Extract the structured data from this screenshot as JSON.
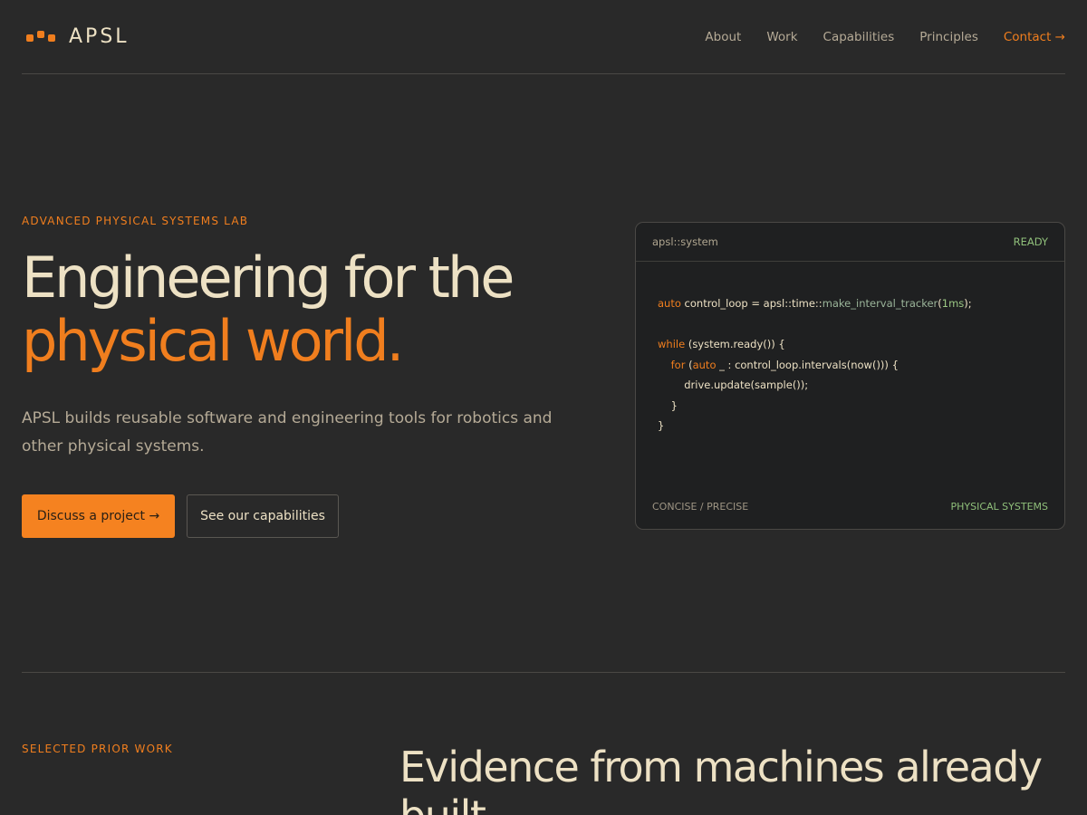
{
  "brand": {
    "name": "APSL"
  },
  "nav": {
    "items": [
      "About",
      "Work",
      "Capabilities",
      "Principles"
    ],
    "contact": "Contact →"
  },
  "hero": {
    "eyebrow": "ADVANCED PHYSICAL SYSTEMS LAB",
    "headline_line1": "Engineering for the",
    "headline_line2": "physical world.",
    "lede": "APSL builds reusable software and engineering tools for robotics and other physical systems.",
    "primary_cta": "Discuss a project →",
    "secondary_cta": "See our capabilities"
  },
  "code_card": {
    "title": "apsl::system",
    "status": "READY",
    "footer_left": "CONCISE / PRECISE",
    "footer_right": "PHYSICAL SYSTEMS",
    "lines": [
      [
        {
          "t": "kw",
          "s": "auto"
        },
        {
          "t": "txt",
          "s": " control_loop = apsl::time::"
        },
        {
          "t": "fn",
          "s": "make_interval_tracker"
        },
        {
          "t": "txt",
          "s": "("
        },
        {
          "t": "num",
          "s": "1ms"
        },
        {
          "t": "txt",
          "s": ");"
        }
      ],
      [],
      [
        {
          "t": "kw",
          "s": "while"
        },
        {
          "t": "txt",
          "s": " (system.ready()) {"
        }
      ],
      [
        {
          "t": "txt",
          "s": "    "
        },
        {
          "t": "kw",
          "s": "for"
        },
        {
          "t": "txt",
          "s": " ("
        },
        {
          "t": "kw",
          "s": "auto"
        },
        {
          "t": "txt",
          "s": " _ : control_loop.intervals(now())) {"
        }
      ],
      [
        {
          "t": "txt",
          "s": "        drive.update(sample());"
        }
      ],
      [
        {
          "t": "txt",
          "s": "    }"
        }
      ],
      [
        {
          "t": "txt",
          "s": "}"
        }
      ]
    ]
  },
  "work": {
    "eyebrow": "SELECTED PRIOR WORK",
    "title": "Evidence from machines already built."
  },
  "colors": {
    "accent": "#f07e1e",
    "background": "#292929",
    "text": "#ede1c4",
    "muted": "#b5aa96",
    "status_green": "#8fbf7a"
  }
}
